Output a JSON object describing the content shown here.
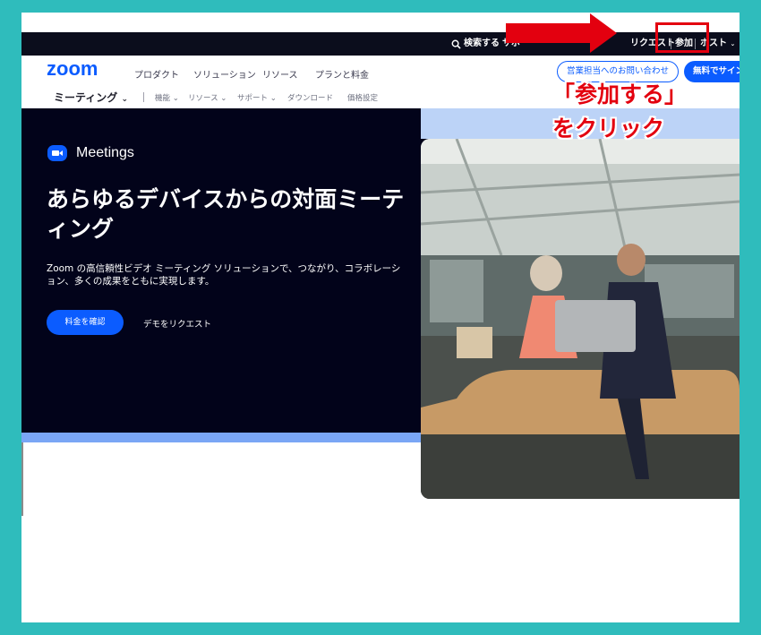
{
  "topbar": {
    "search_label": "検索する",
    "support_label": "サポー",
    "request_label": "リクエスト",
    "join_label": "参加",
    "host_label": "ホスト"
  },
  "nav": {
    "logo": "zoom",
    "items": [
      "プロダクト",
      "ソリューション",
      "リソース",
      "プランと料金"
    ],
    "contact_label": "営業担当へのお問い合わせ",
    "signup_label": "無料でサイン"
  },
  "subnav": {
    "title": "ミーティング",
    "items": [
      "機能",
      "リソース",
      "サポート",
      "ダウンロード",
      "価格設定"
    ]
  },
  "hero": {
    "badge": "Meetings",
    "title": "あらゆるデバイスからの対面ミーティング",
    "description": "Zoom の高信頼性ビデオ ミーティング ソリューションで、つながり、コラボレーション、多くの成果をともに実現します。",
    "price_button": "料金を確認",
    "demo_link": "デモをリクエスト"
  },
  "annotation": {
    "line1": "「参加する」",
    "line2": "をクリック",
    "color": "#e3000f"
  },
  "colors": {
    "frame": "#2fbcbc",
    "brand": "#0b5cff",
    "hero_bg": "#02031a",
    "topbar_bg": "#0b0d1c"
  }
}
